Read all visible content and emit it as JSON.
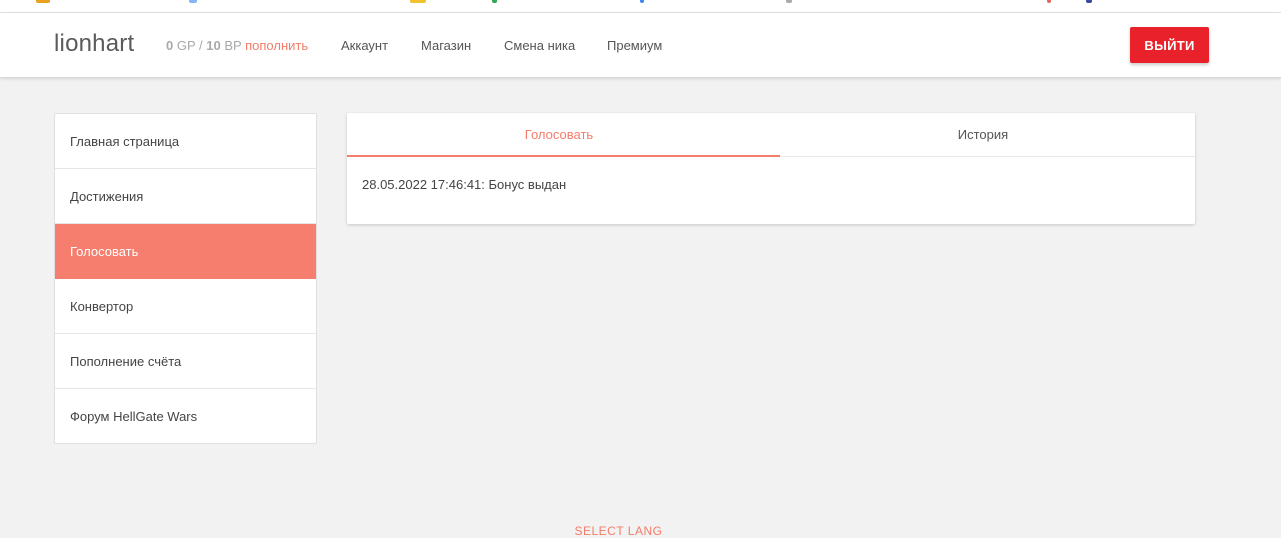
{
  "header": {
    "brand": "lionhart",
    "balance": {
      "gp_value": "0",
      "gp_unit": "GP",
      "separator": "/",
      "bp_value": "10",
      "bp_unit": "BP",
      "topup_label": "пополнить"
    },
    "nav": [
      "Аккаунт",
      "Магазин",
      "Смена ника",
      "Премиум"
    ],
    "logout_label": "ВЫЙТИ"
  },
  "sidebar": {
    "items": [
      {
        "label": "Главная страница",
        "active": false
      },
      {
        "label": "Достижения",
        "active": false
      },
      {
        "label": "Голосовать",
        "active": true
      },
      {
        "label": "Конвертор",
        "active": false
      },
      {
        "label": "Пополнение счёта",
        "active": false
      },
      {
        "label": "Форум HellGate Wars",
        "active": false
      }
    ]
  },
  "panel": {
    "tabs": [
      {
        "label": "Голосовать",
        "active": true
      },
      {
        "label": "История",
        "active": false
      }
    ],
    "entry": "28.05.2022 17:46:41: Бонус выдан"
  },
  "footer": {
    "lang_label": "SELECT LANG"
  },
  "colors": {
    "accent": "#f47c6a",
    "active_item": "#f67e6e",
    "logout": "#e8212a"
  }
}
